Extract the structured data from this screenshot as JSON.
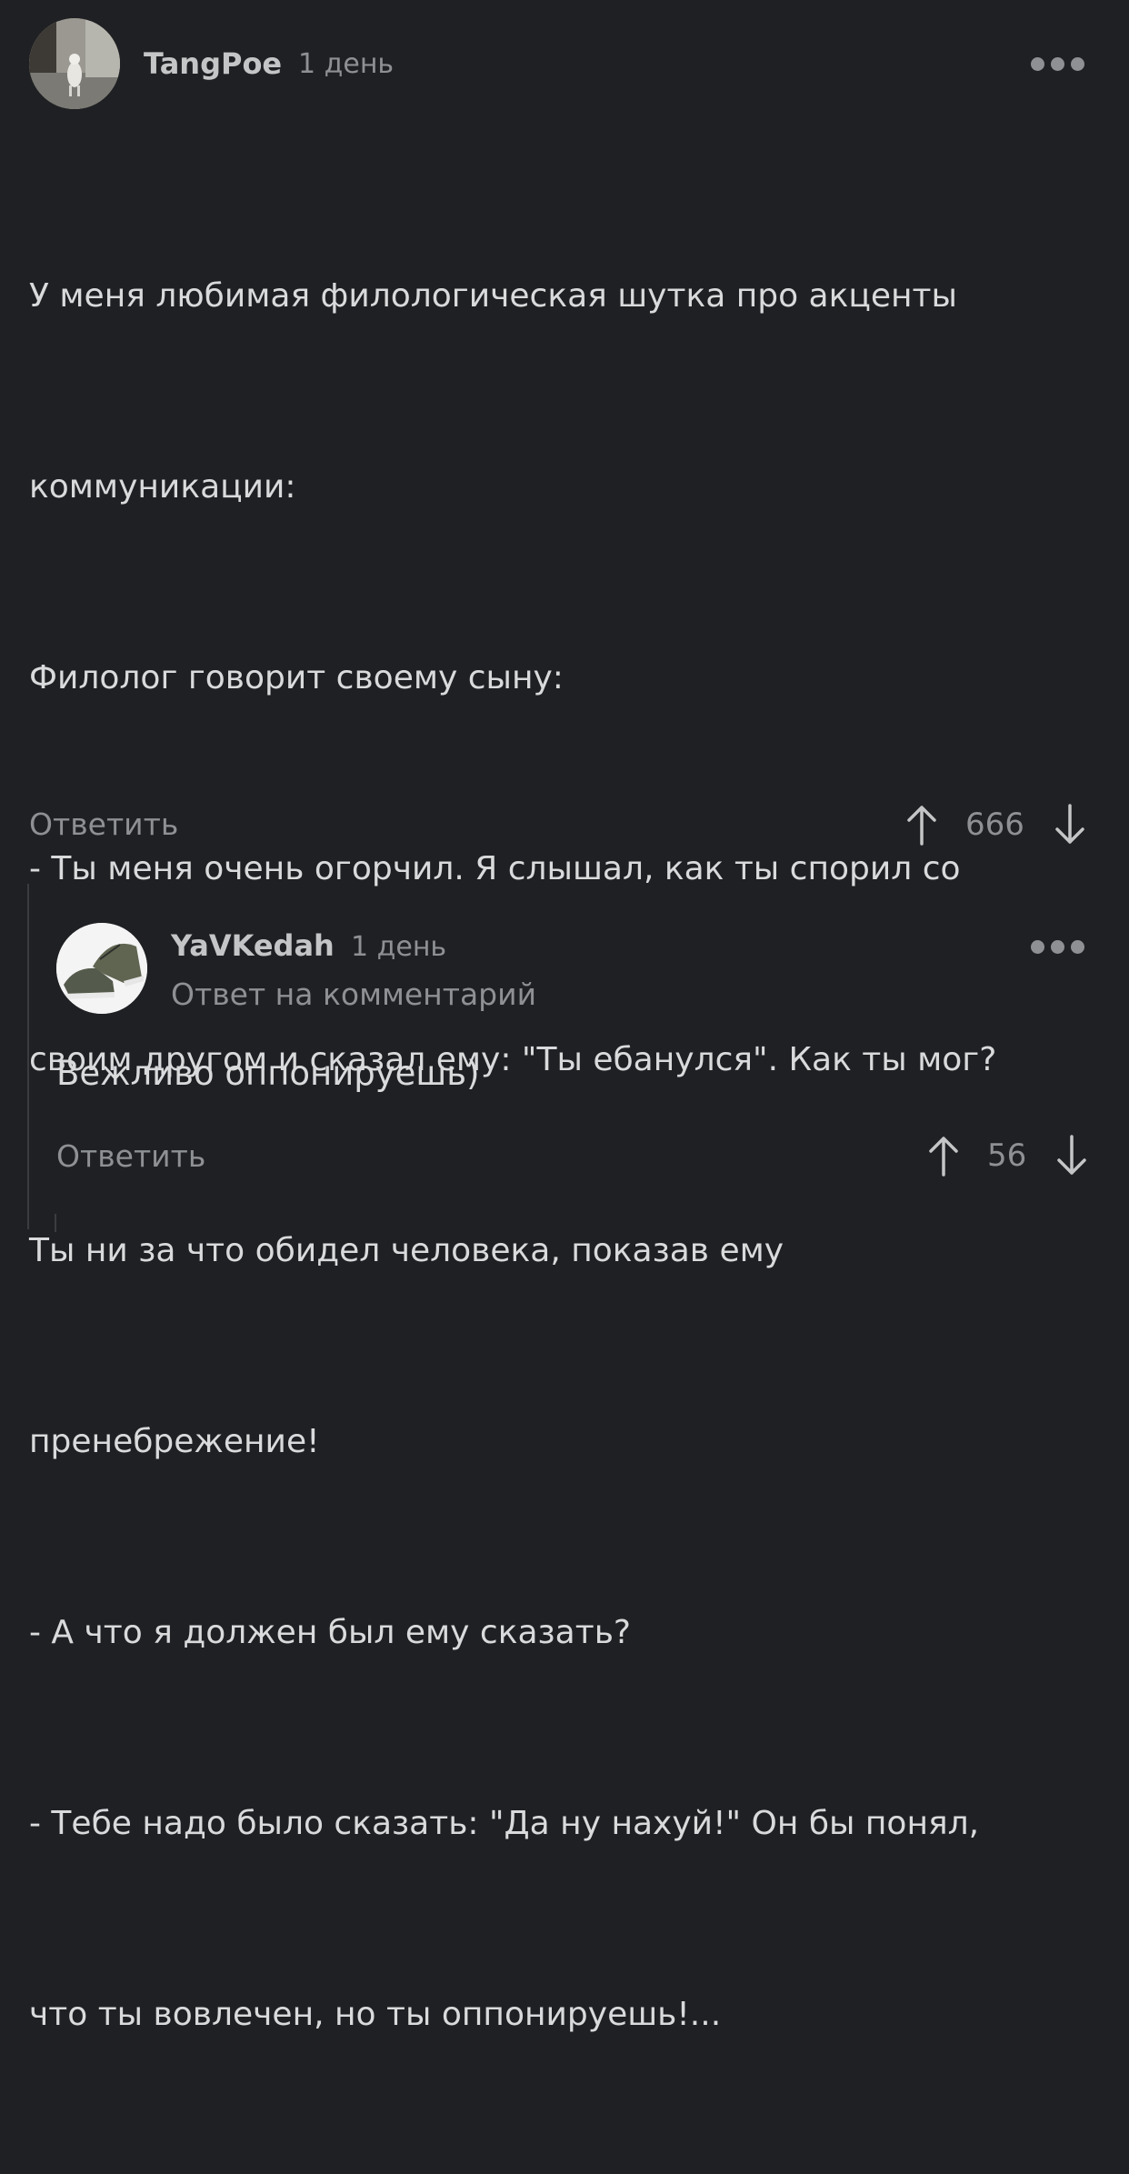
{
  "comments": [
    {
      "username": "TangPoe",
      "time": "1 день",
      "avatar_icon": "cat-photo-avatar",
      "text_lines": [
        "У меня любимая филологическая шутка про акценты",
        "коммуникации:",
        "Филолог говорит своему сыну:",
        "- Ты меня очень огорчил. Я слышал, как ты спорил со",
        "своим другом и сказал ему: \"Ты ебанулся\". Как ты мог?",
        "Ты ни за что обидел человека, показав ему",
        "пренебрежение!",
        "- А что я должен был ему сказать?",
        "- Тебе надо было сказать: \"Да ну нахуй!\" Он бы понял,",
        "что ты вовлечен, но ты оппонируешь!..."
      ],
      "reply_label": "Ответить",
      "rating": "666"
    },
    {
      "username": "YaVKedah",
      "time": "1 день",
      "subtitle": "Ответ на комментарий",
      "avatar_icon": "sneakers-photo-avatar",
      "text": "Вежливо оппонируешь)",
      "reply_label": "Ответить",
      "rating": "56"
    }
  ],
  "colors": {
    "background": "#1e2023",
    "text": "#d9dadb",
    "muted": "#8e9093"
  }
}
